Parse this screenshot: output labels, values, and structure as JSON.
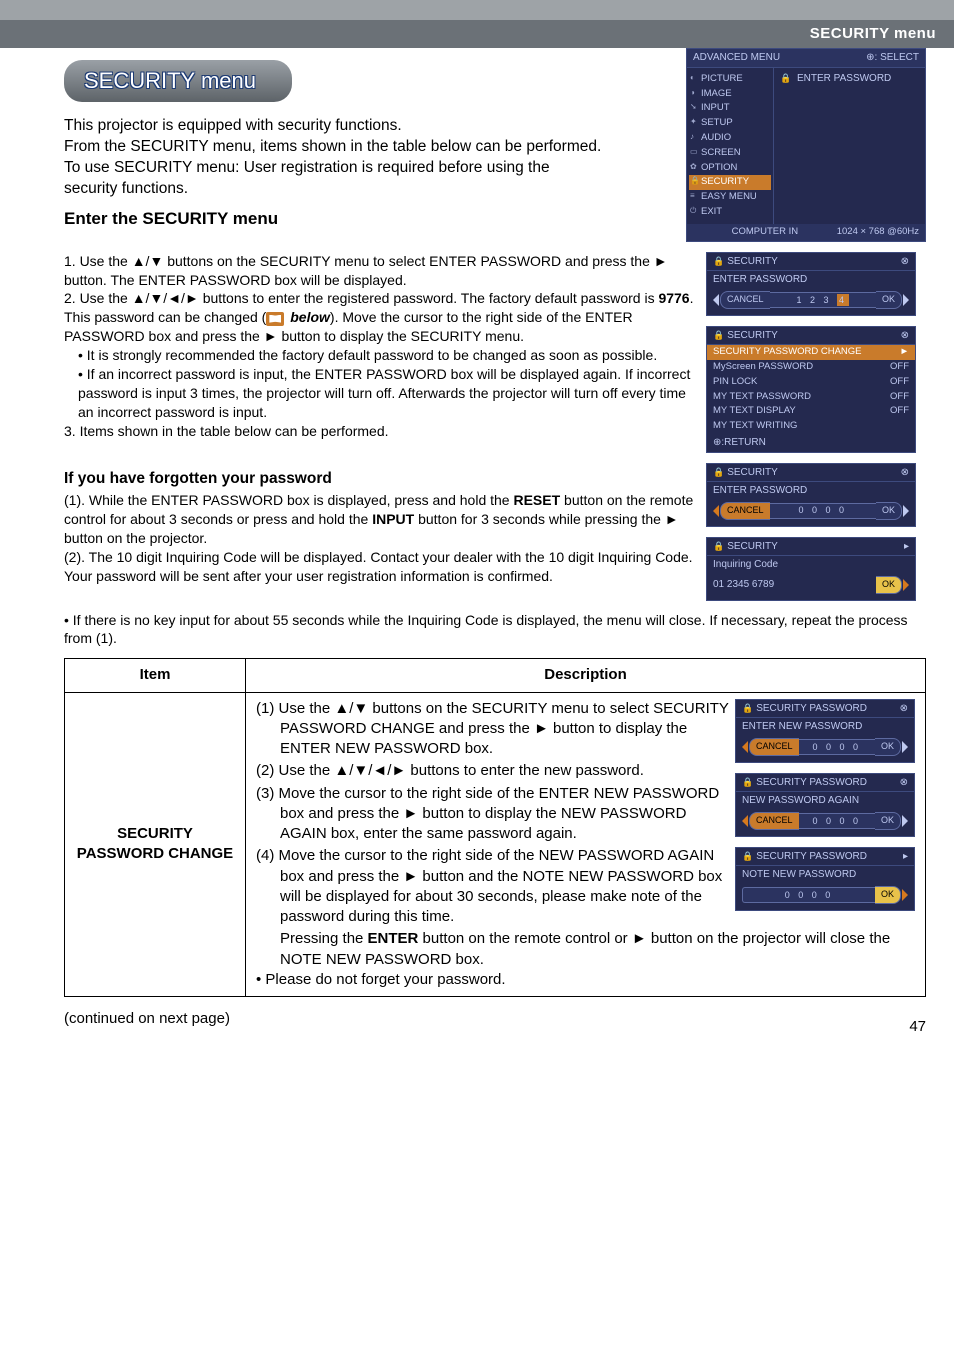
{
  "header": {
    "menu_label": "SECURITY menu",
    "title": "SECURITY menu"
  },
  "intro": {
    "p1": "This projector is equipped with security functions.",
    "p2": "From the SECURITY menu, items shown in the table below can be performed.",
    "p3": "To use SECURITY menu: User registration is required before using the security functions."
  },
  "enter_heading": "Enter the SECURITY menu",
  "steps": {
    "s1": "1. Use the ▲/▼ buttons on the SECURITY menu to select ENTER PASSWORD and press the ► button. The ENTER PASSWORD box will be displayed.",
    "s2a": "2. Use the ▲/▼/◄/► buttons to enter the registered password. The factory default password is ",
    "s2_default": "9776",
    "s2b": ". This password can be changed (",
    "s2_below": "below",
    "s2c": "). Move the cursor to the right side of the ENTER PASSWORD box and press the ► button to display the SECURITY menu.",
    "s2_bullet1": "• It is strongly recommended the factory default password to be changed as soon as possible.",
    "s2_bullet2": "• If an incorrect password is input, the ENTER PASSWORD box will be displayed again. If incorrect password is input 3 times, the projector will turn off. Afterwards the projector will turn off every time an incorrect password is input.",
    "s3": "3. Items shown in the table below can be performed."
  },
  "forgot_heading": "If you have forgotten your password",
  "forgot": {
    "f1a": "(1). While the ENTER PASSWORD box is displayed, press and hold the ",
    "f1_reset": "RESET",
    "f1b": " button on the remote control for about 3 seconds or press and hold the ",
    "f1_input": "INPUT",
    "f1c": " button for 3 seconds while pressing the ► button on the projector.",
    "f2": "(2). The 10 digit Inquiring Code will be displayed. Contact your dealer with the 10 digit Inquiring Code. Your password will be sent after your user registration information is confirmed.",
    "note": "• If there is no key input for about 55 seconds while the Inquiring Code is displayed, the menu will close. If necessary, repeat the process from (1)."
  },
  "table": {
    "col_item": "Item",
    "col_desc": "Description",
    "row1_item": "SECURITY PASSWORD CHANGE",
    "row1": {
      "d1": "(1) Use the ▲/▼ buttons on the SECURITY menu to select SECURITY PASSWORD CHANGE and press the ► button to display the ENTER NEW PASSWORD box.",
      "d2": "(2) Use the ▲/▼/◄/► buttons to enter the new password.",
      "d3": "(3) Move the cursor to the right side of the ENTER NEW PASSWORD box and press the ► button to display the NEW PASSWORD AGAIN box, enter the same password again.",
      "d4a": "(4) Move the cursor to the right side of the NEW PASSWORD AGAIN box and press the ► button and the NOTE NEW PASSWORD box will be displayed for about 30 seconds, please make note of the password during this time.",
      "d4b_pre": "Pressing the ",
      "d4b_enter": "ENTER",
      "d4b_post": " button on the remote control or ► button on the projector will close the NOTE NEW PASSWORD box.",
      "bullet": "• Please do not forget your password."
    }
  },
  "continued": "(continued on next page)",
  "page_number": "47",
  "osd_main": {
    "top_left": "ADVANCED MENU",
    "top_right": "⊕: SELECT",
    "nav": [
      "PICTURE",
      "IMAGE",
      "INPUT",
      "SETUP",
      "AUDIO",
      "SCREEN",
      "OPTION",
      "SECURITY",
      "EASY MENU",
      "EXIT"
    ],
    "main_label": "ENTER PASSWORD",
    "foot_left": "COMPUTER IN",
    "foot_right": "1024 × 768 @60Hz"
  },
  "osd_enter_pw": {
    "title": "SECURITY",
    "label": "ENTER PASSWORD",
    "cancel": "CANCEL",
    "ok": "OK",
    "digits_before": "1 2 3",
    "cursor_digit": "4"
  },
  "osd_security_list": {
    "title": "SECURITY",
    "items": [
      {
        "name": "SECURITY PASSWORD CHANGE",
        "val": ""
      },
      {
        "name": "MyScreen PASSWORD",
        "val": "OFF"
      },
      {
        "name": "PIN LOCK",
        "val": "OFF"
      },
      {
        "name": "MY TEXT PASSWORD",
        "val": "OFF"
      },
      {
        "name": "MY TEXT DISPLAY",
        "val": "OFF"
      },
      {
        "name": "MY TEXT WRITING",
        "val": ""
      }
    ],
    "return": "⊕:RETURN"
  },
  "osd_forgot1": {
    "title": "SECURITY",
    "label": "ENTER PASSWORD",
    "cancel": "CANCEL",
    "digits": "0 0 0 0",
    "ok": "OK"
  },
  "osd_inquiring": {
    "title": "SECURITY",
    "label": "Inquiring Code",
    "code": "01 2345 6789",
    "ok": "OK"
  },
  "osd_new_pw": {
    "title": "SECURITY PASSWORD",
    "label": "ENTER NEW PASSWORD",
    "cancel": "CANCEL",
    "digits": "0 0 0 0",
    "ok": "OK"
  },
  "osd_again": {
    "title": "SECURITY PASSWORD",
    "label": "NEW PASSWORD AGAIN",
    "cancel": "CANCEL",
    "digits": "0 0 0 0",
    "ok": "OK"
  },
  "osd_note": {
    "title": "SECURITY PASSWORD",
    "label": "NOTE NEW PASSWORD",
    "digits": "0 0 0 0",
    "ok": "OK"
  }
}
